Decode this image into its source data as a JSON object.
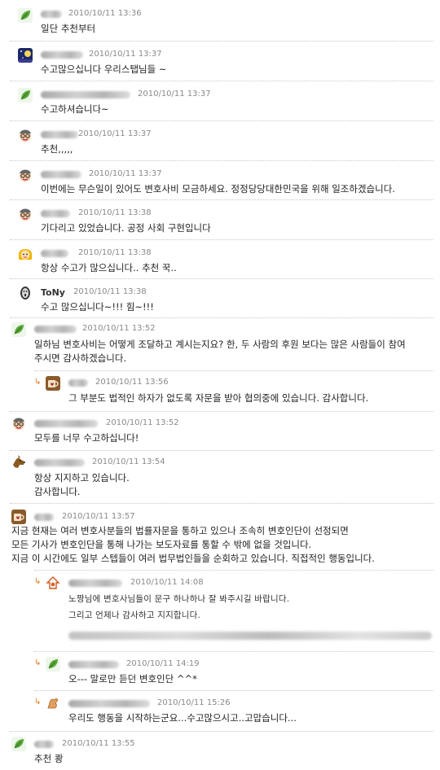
{
  "comments": [
    {
      "time": "2010/10/11 13:36",
      "text": "일단 추천부터",
      "avatar": "leaf-icon"
    },
    {
      "time": "2010/10/11 13:37",
      "text": "수고많으십니다 우리스탭님들 ~",
      "avatar": "moon-night-icon"
    },
    {
      "time": "2010/10/11 13:37",
      "text": "수고하셔습니다~",
      "avatar": "leaf-icon"
    },
    {
      "time": "2010/10/11 13:37",
      "text": "추천,,,,,",
      "avatar": "face-glasses-icon"
    },
    {
      "time": "2010/10/11 13:37",
      "text": "이번에는 무슨일이 있어도 변호사비 모금하세요. 정정당당대한민국을 위해 일조하겠습니다.",
      "avatar": "face-glasses-icon"
    },
    {
      "time": "2010/10/11 13:38",
      "text": "기다리고 있었습니다. 공정 사회 구현입니다",
      "avatar": "face-glasses-icon"
    },
    {
      "time": "2010/10/11 13:38",
      "text": "항상 수고가 많으십니다.. 추천 꾹..",
      "avatar": "face-yellow-icon"
    },
    {
      "time": "2010/10/11 13:38",
      "text": "수고 많으십니다~!!! 힘~!!!",
      "avatar": "scream-face-icon",
      "nick": "ToNy"
    },
    {
      "time": "2010/10/11 13:52",
      "text": "일하님 변호사비는 어떻게 조달하고 계시는지요? 한, 두 사람의 후원 보다는 많은 사람들이 참여\n주시면 감사하겠습니다.",
      "avatar": "leaf-icon"
    },
    {
      "time": "2010/10/11 13:56",
      "text": "그 부분도 법적인 하자가 없도록 자문을 받아 협의중에 있습니다. 감사합니다.",
      "avatar": "cup-icon",
      "reply": true
    },
    {
      "time": "2010/10/11 13:52",
      "text": "모두를 너무 수고하십니다!",
      "avatar": "face-glasses-icon"
    },
    {
      "time": "2010/10/11 13:54",
      "text": "항상 지지하고 있습니다.\n감사합니다.",
      "avatar": "dog-icon"
    },
    {
      "time": "2010/10/11 13:57",
      "text": "지금 현재는 여러 변호사분들의 법률자문을 통하고 있으나 조속히 변호인단이 선정되면\n모든 기사가 변호인단을 통해 나가는 보도자료를 통할 수 밖에 없을 것입니다.\n지금 이 시간에도 일부 스텝들이 여러 법무법인들을 순회하고 있습니다. 직접적인 행동입니다.",
      "avatar": "cup-icon"
    },
    {
      "time": "2010/10/11 14:08",
      "text": "노짱님에 변호사님들이 문구 하나하나 잘 봐주시길 바랍니다.\n그리고 언제나 감사하고 지지합니다.",
      "avatar": "house-icon",
      "reply": true
    },
    {
      "time": "2010/10/11 14:19",
      "text": "오--- 말로만 듣던 변호인단 ^^*",
      "avatar": "leaf-icon",
      "reply": true
    },
    {
      "time": "2010/10/11 15:26",
      "text": "우리도 행동을 시작하는군요...수고많으시고..고맙습니다...",
      "avatar": "muscle-arm-icon",
      "reply": true
    },
    {
      "time": "2010/10/11 13:55",
      "text": "추천 쾅",
      "avatar": "leaf-icon"
    }
  ],
  "colors": {
    "reply_arrow": "#e87b1a",
    "timestamp": "#8a8a8a",
    "separator": "#c8c8c8"
  }
}
